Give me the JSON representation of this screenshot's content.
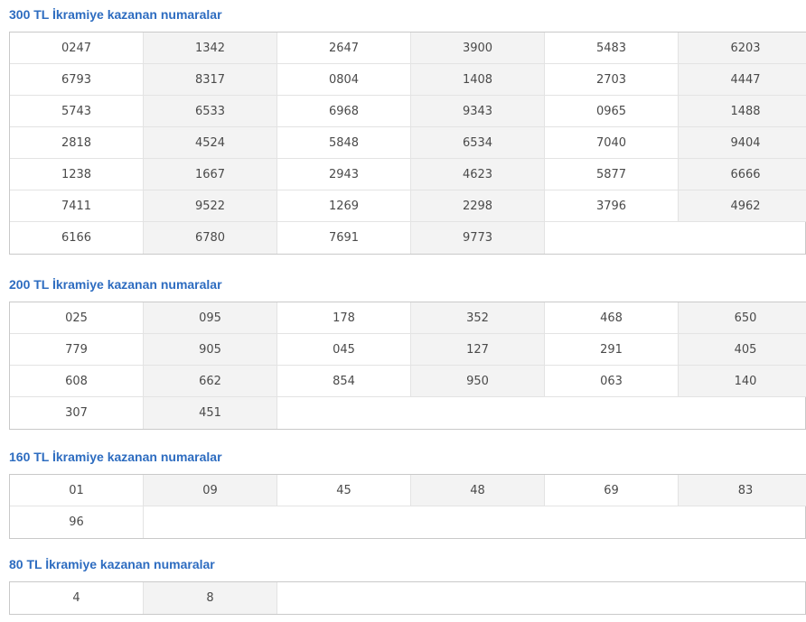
{
  "sections": [
    {
      "title": "300 TL İkramiye kazanan numaralar",
      "numbers": [
        "0247",
        "1342",
        "2647",
        "3900",
        "5483",
        "6203",
        "6793",
        "8317",
        "0804",
        "1408",
        "2703",
        "4447",
        "5743",
        "6533",
        "6968",
        "9343",
        "0965",
        "1488",
        "2818",
        "4524",
        "5848",
        "6534",
        "7040",
        "9404",
        "1238",
        "1667",
        "2943",
        "4623",
        "5877",
        "6666",
        "7411",
        "9522",
        "1269",
        "2298",
        "3796",
        "4962",
        "6166",
        "6780",
        "7691",
        "9773"
      ]
    },
    {
      "title": "200 TL İkramiye kazanan numaralar",
      "numbers": [
        "025",
        "095",
        "178",
        "352",
        "468",
        "650",
        "779",
        "905",
        "045",
        "127",
        "291",
        "405",
        "608",
        "662",
        "854",
        "950",
        "063",
        "140",
        "307",
        "451"
      ]
    },
    {
      "title": "160 TL İkramiye kazanan numaralar",
      "numbers": [
        "01",
        "09",
        "45",
        "48",
        "69",
        "83",
        "96"
      ]
    },
    {
      "title": "80 TL İkramiye kazanan numaralar",
      "numbers": [
        "4",
        "8"
      ]
    }
  ]
}
